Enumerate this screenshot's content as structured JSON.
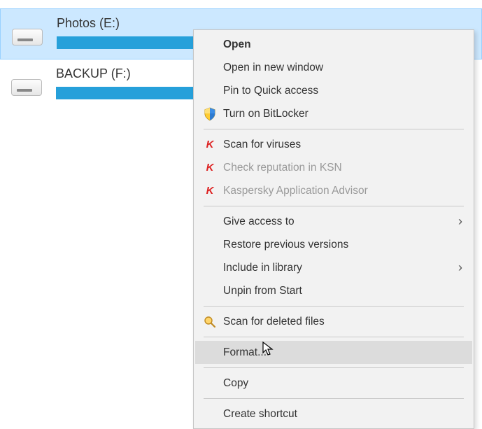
{
  "drives": [
    {
      "label": "Photos (E:)",
      "selected": true
    },
    {
      "label": "BACKUP (F:)",
      "selected": false
    }
  ],
  "menu": {
    "open": "Open",
    "open_new_window": "Open in new window",
    "pin_quick_access": "Pin to Quick access",
    "bitlocker": "Turn on BitLocker",
    "scan_viruses": "Scan for viruses",
    "check_ksn": "Check reputation in KSN",
    "kaspersky_advisor": "Kaspersky Application Advisor",
    "give_access": "Give access to",
    "restore_versions": "Restore previous versions",
    "include_library": "Include in library",
    "unpin_start": "Unpin from Start",
    "scan_deleted": "Scan for deleted files",
    "format": "Format...",
    "copy": "Copy",
    "create_shortcut": "Create shortcut"
  }
}
